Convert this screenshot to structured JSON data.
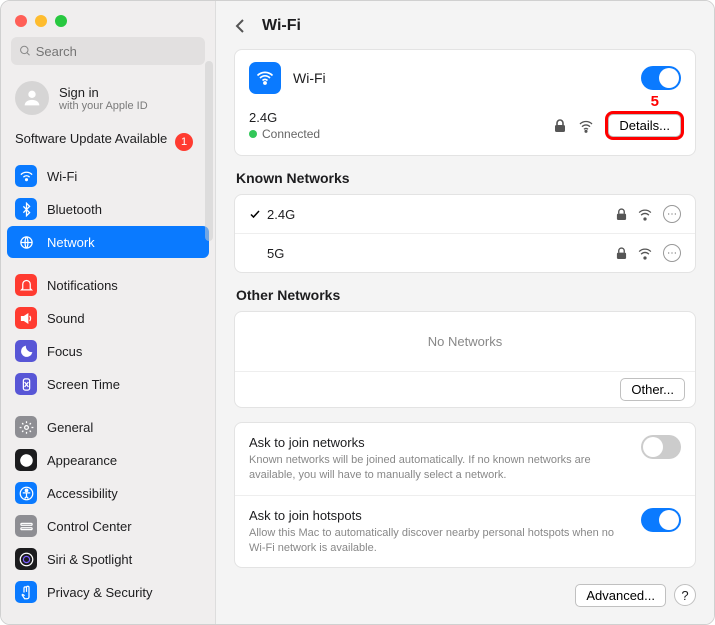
{
  "sidebar": {
    "search_placeholder": "Search",
    "signin": {
      "title": "Sign in",
      "subtitle": "with your Apple ID"
    },
    "update": {
      "label": "Software Update Available",
      "badge": "1"
    },
    "items": [
      {
        "label": "Wi-Fi",
        "color": "#0a7aff"
      },
      {
        "label": "Bluetooth",
        "color": "#0a7aff"
      },
      {
        "label": "Network",
        "color": "#0a7aff",
        "active": true
      },
      {
        "label": "Notifications",
        "color": "#ff3b30"
      },
      {
        "label": "Sound",
        "color": "#ff3b30"
      },
      {
        "label": "Focus",
        "color": "#5856d6"
      },
      {
        "label": "Screen Time",
        "color": "#5856d6"
      },
      {
        "label": "General",
        "color": "#8e8e93"
      },
      {
        "label": "Appearance",
        "color": "#1c1c1e"
      },
      {
        "label": "Accessibility",
        "color": "#0a7aff"
      },
      {
        "label": "Control Center",
        "color": "#8e8e93"
      },
      {
        "label": "Siri & Spotlight",
        "color": "#1c1c1e"
      },
      {
        "label": "Privacy & Security",
        "color": "#0a7aff"
      }
    ]
  },
  "header": {
    "title": "Wi-Fi"
  },
  "wifi_card": {
    "title": "Wi-Fi",
    "toggle_on": true,
    "ssid": "2.4G",
    "status": "Connected",
    "details_label": "Details...",
    "annotation": "5"
  },
  "known": {
    "title": "Known Networks",
    "networks": [
      {
        "name": "2.4G",
        "connected": true,
        "locked": true
      },
      {
        "name": "5G",
        "connected": false,
        "locked": true
      }
    ]
  },
  "other": {
    "title": "Other Networks",
    "empty": "No Networks",
    "other_btn": "Other..."
  },
  "ask": [
    {
      "title": "Ask to join networks",
      "desc": "Known networks will be joined automatically. If no known networks are available, you will have to manually select a network.",
      "on": false
    },
    {
      "title": "Ask to join hotspots",
      "desc": "Allow this Mac to automatically discover nearby personal hotspots when no Wi-Fi network is available.",
      "on": true
    }
  ],
  "footer": {
    "advanced": "Advanced...",
    "help": "?"
  }
}
